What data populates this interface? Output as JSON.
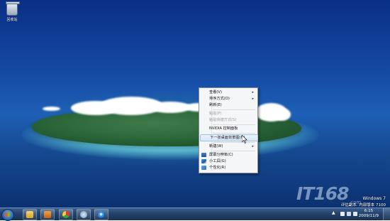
{
  "desktop": {
    "icons": [
      {
        "label": "回收站",
        "icon": "recycle-bin-icon"
      }
    ]
  },
  "context_menu": {
    "items": [
      {
        "label": "查看(V)",
        "submenu": true
      },
      {
        "label": "排序方式(O)",
        "submenu": true
      },
      {
        "label": "刷新(E)"
      },
      {
        "label": "粘贴(P)",
        "disabled": true
      },
      {
        "label": "粘贴快捷方式(S)",
        "disabled": true
      },
      {
        "label": "NVIDIA 控制面板"
      },
      {
        "label": "下一张桌面背景图(N)",
        "highlighted": true
      },
      {
        "label": "新建(W)",
        "submenu": true
      },
      {
        "label": "屏幕分辨率(C)",
        "icon": "screen-resolution-icon"
      },
      {
        "label": "小工具(G)",
        "icon": "gadgets-icon"
      },
      {
        "label": "个性化(R)",
        "icon": "personalize-icon"
      }
    ]
  },
  "watermark": {
    "brand": "IT168",
    "sub": ".com"
  },
  "windows_info": {
    "line1": "Windows 7",
    "line2": "评估副本. 内部版本 7100"
  },
  "taskbar": {
    "pinned": [
      "folder-icon",
      "media-player-icon",
      "chrome-icon",
      "network-icon",
      "ie-icon"
    ],
    "clock_time": "6:15",
    "clock_date": "2009/11/9"
  },
  "colors": {
    "menu_highlight": "#d6e8fa",
    "taskbar": "#24426c"
  }
}
